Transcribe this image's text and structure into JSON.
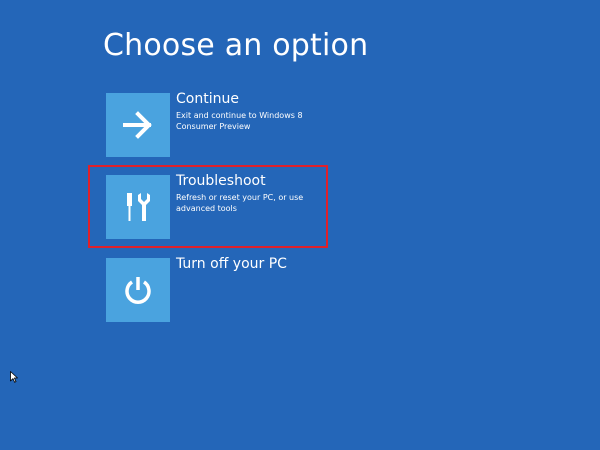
{
  "page": {
    "title": "Choose an option"
  },
  "options": [
    {
      "label": "Continue",
      "description": "Exit and continue to Windows 8 Consumer Preview",
      "icon": "arrow-right-icon"
    },
    {
      "label": "Troubleshoot",
      "description": "Refresh or reset your PC, or use advanced tools",
      "icon": "tools-icon"
    },
    {
      "label": "Turn off your PC",
      "description": "",
      "icon": "power-icon"
    }
  ],
  "colors": {
    "background": "#2466b8",
    "tile": "#4aa3df",
    "text": "#ffffff",
    "highlight": "#e0202a"
  }
}
